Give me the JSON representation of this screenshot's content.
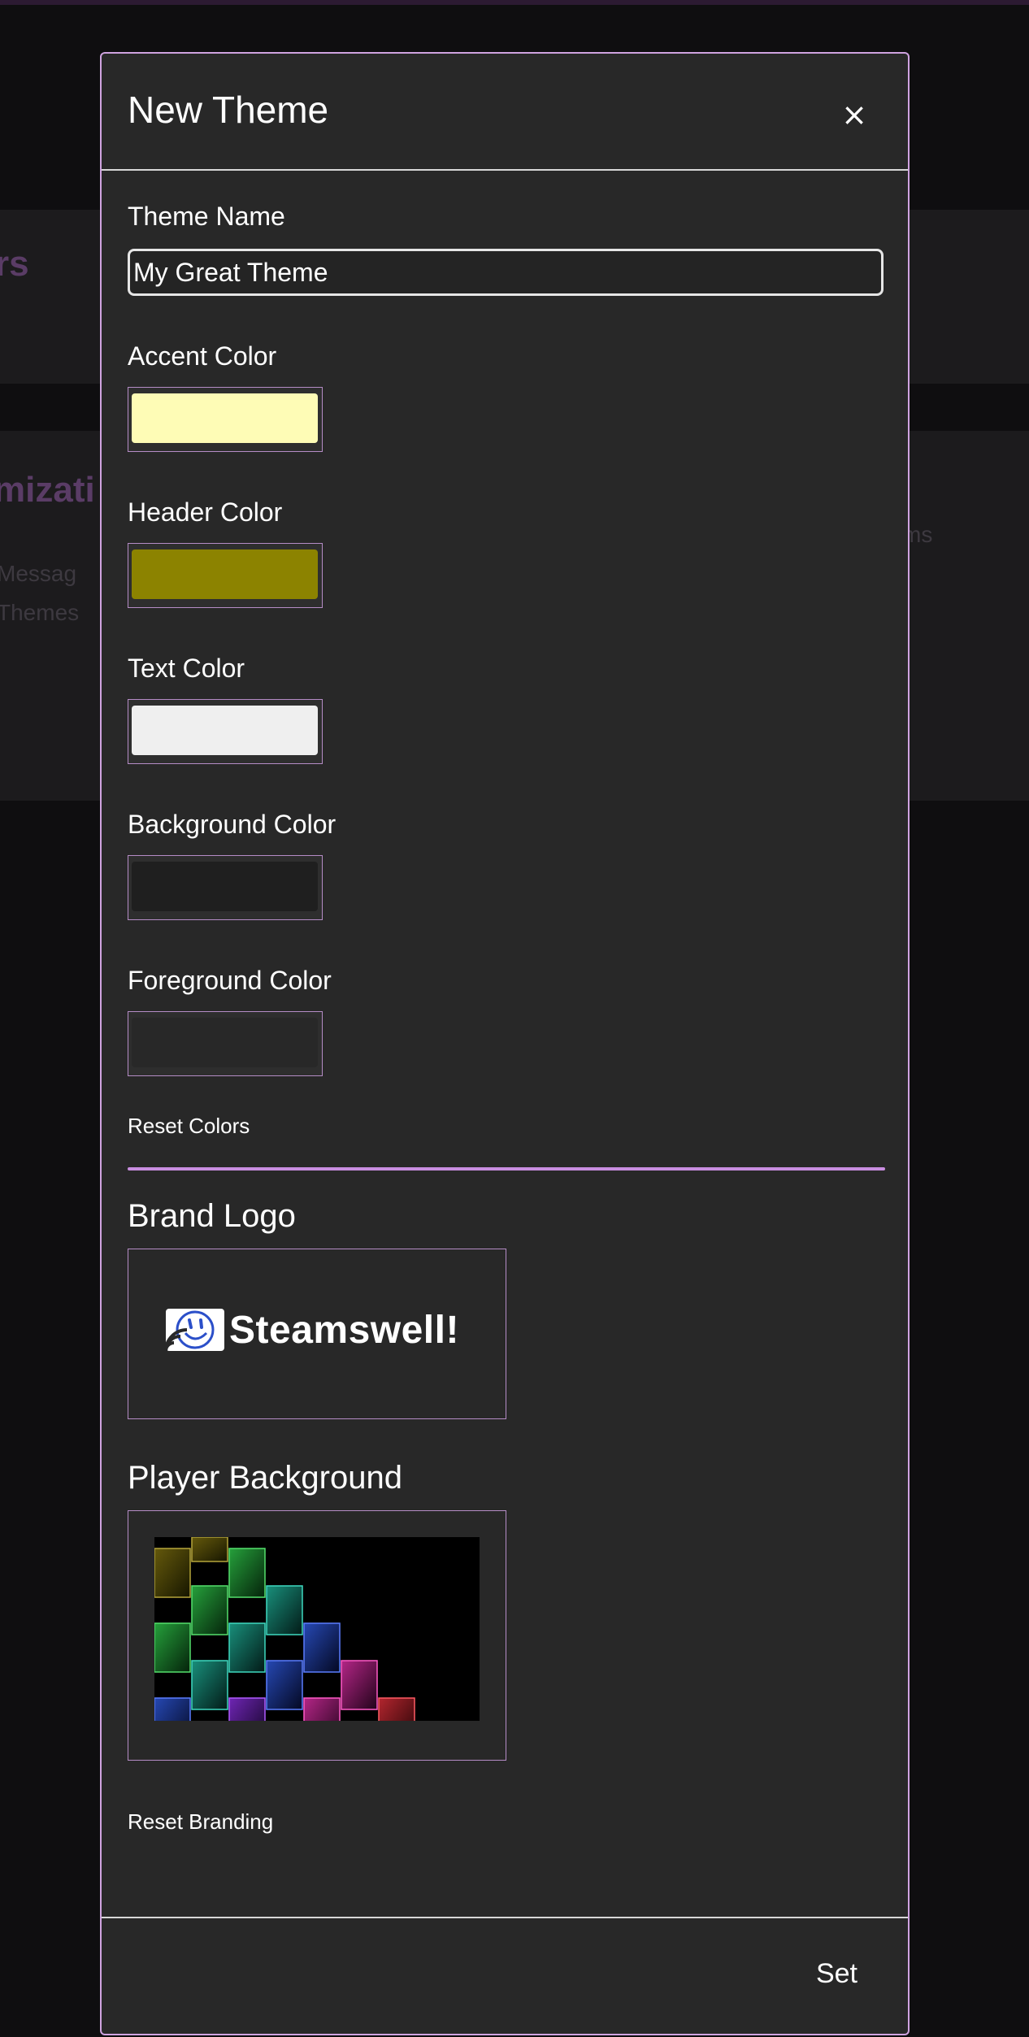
{
  "background_page": {
    "heading_fragment": "rs",
    "section_fragment": "mizati",
    "item_1": "Messag",
    "item_2": "Themes",
    "right_fragment": "ms"
  },
  "modal": {
    "title": "New Theme",
    "close_label": "×",
    "theme_name_label": "Theme Name",
    "theme_name_value": "My Great Theme",
    "colors": [
      {
        "label": "Accent Color",
        "value": "#fefcb6"
      },
      {
        "label": "Header Color",
        "value": "#8c8300"
      },
      {
        "label": "Text Color",
        "value": "#efefef"
      },
      {
        "label": "Background Color",
        "value": "#1f1f1f"
      },
      {
        "label": "Foreground Color",
        "value": "#282828"
      }
    ],
    "reset_colors_label": "Reset Colors",
    "brand_logo_title": "Brand Logo",
    "brand_logo_text": "Steamswell!",
    "player_background_title": "Player Background",
    "reset_branding_label": "Reset Branding",
    "set_label": "Set"
  },
  "colors": {
    "modal_border": "#cfa3e0",
    "divider": "#c98ee0",
    "logo_icon": "#2b4fc9"
  }
}
